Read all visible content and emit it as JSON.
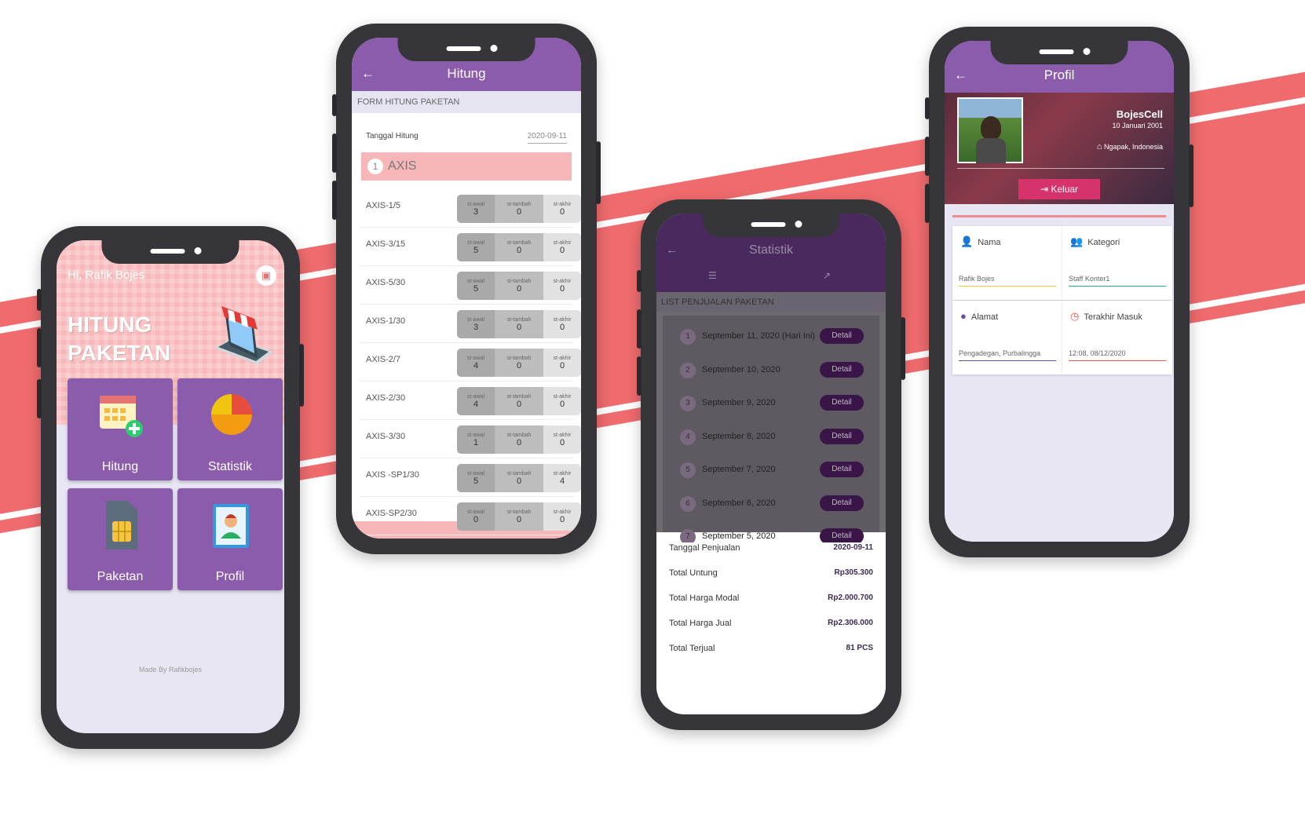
{
  "colors": {
    "band": "#ef6b6e",
    "purple": "#8b5cab",
    "pink": "#f7b7b8",
    "dark": "#36353a"
  },
  "home": {
    "greeting": "Hi, Rafik Bojes",
    "hero_title_1": "HITUNG",
    "hero_title_2": "PAKETAN",
    "store_icon": "store-icon",
    "tiles": [
      {
        "label": "Hitung",
        "icon": "calendar-add-icon"
      },
      {
        "label": "Statistik",
        "icon": "pie-chart-icon"
      },
      {
        "label": "Paketan",
        "icon": "sim-card-icon"
      },
      {
        "label": "Profil",
        "icon": "profile-card-icon"
      }
    ],
    "footer": "Made By Rafikbojes"
  },
  "hitung": {
    "title": "Hitung",
    "section": "FORM HITUNG PAKETAN",
    "date_label": "Tanggal Hitung",
    "date_value": "2020-09-11",
    "group_num": "1",
    "group_name": "AXIS",
    "col_labels": [
      "st-awal",
      "st-tambah",
      "st-akhir"
    ],
    "rows": [
      {
        "name": "AXIS-1/5",
        "v": [
          "3",
          "0",
          "0"
        ]
      },
      {
        "name": "AXIS-3/15",
        "v": [
          "5",
          "0",
          "0"
        ]
      },
      {
        "name": "AXIS-5/30",
        "v": [
          "5",
          "0",
          "0"
        ]
      },
      {
        "name": "AXIS-1/30",
        "v": [
          "3",
          "0",
          "0"
        ]
      },
      {
        "name": "AXIS-2/7",
        "v": [
          "4",
          "0",
          "0"
        ]
      },
      {
        "name": "AXIS-2/30",
        "v": [
          "4",
          "0",
          "0"
        ]
      },
      {
        "name": "AXIS-3/30",
        "v": [
          "1",
          "0",
          "0"
        ]
      },
      {
        "name": "AXIS -SP1/30",
        "v": [
          "5",
          "0",
          "4"
        ]
      },
      {
        "name": "AXIS-SP2/30",
        "v": [
          "0",
          "0",
          "0"
        ]
      }
    ]
  },
  "statistik": {
    "title": "Statistik",
    "section": "LIST PENJUALAN PAKETAN",
    "detail_label": "Detail",
    "rows": [
      {
        "n": "1",
        "date": "September 11, 2020 (Hari Ini)"
      },
      {
        "n": "2",
        "date": "September 10, 2020"
      },
      {
        "n": "3",
        "date": "September 9, 2020"
      },
      {
        "n": "4",
        "date": "September 8, 2020"
      },
      {
        "n": "5",
        "date": "September 7, 2020"
      },
      {
        "n": "6",
        "date": "September 6, 2020"
      },
      {
        "n": "7",
        "date": "September 5, 2020"
      }
    ],
    "summary": [
      {
        "label": "Tanggal Penjualan",
        "value": "2020-09-11"
      },
      {
        "label": "Total Untung",
        "value": "Rp305.300"
      },
      {
        "label": "Total Harga Modal",
        "value": "Rp2.000.700"
      },
      {
        "label": "Total Harga Jual",
        "value": "Rp2.306.000"
      },
      {
        "label": "Total Terjual",
        "value": "81 PCS"
      }
    ]
  },
  "profil": {
    "title": "Profil",
    "name": "BojesCell",
    "birth": "10 Januari 2001",
    "location": "Ngapak, Indonesia",
    "logout": "Keluar",
    "fields": [
      {
        "label": "Nama",
        "value": "Rafik Bojes",
        "icon": "user-icon",
        "accent": "#f2c94c"
      },
      {
        "label": "Kategori",
        "value": "Staff Konter1",
        "icon": "group-icon",
        "accent": "#27ae60"
      },
      {
        "label": "Alamat",
        "value": "Pengadegan, Purbalingga",
        "icon": "location-icon",
        "accent": "#6b4ea0"
      },
      {
        "label": "Terakhir Masuk",
        "value": "12:08, 08/12/2020",
        "icon": "timer-icon",
        "accent": "#eb5757"
      }
    ]
  }
}
